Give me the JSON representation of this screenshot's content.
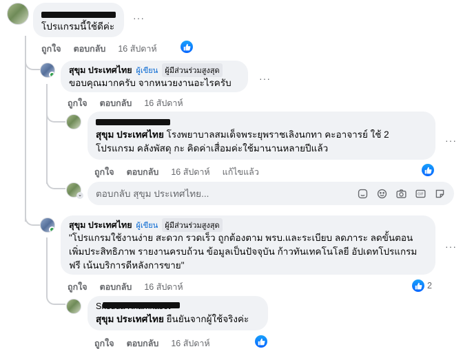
{
  "comments": [
    {
      "text": "โปรแกรมนี้ใช้ดีค่ะ",
      "like": "ถูกใจ",
      "reply": "ตอบกลับ",
      "time": "16 สัปดาห์"
    },
    {
      "name": "สุขุม ประเทศไทย",
      "badge_author": "ผู้เขียน",
      "badge_top": "ผู้มีส่วนร่วมสูงสุด",
      "text": "ขอบคุณมากครับ จากหนวยงานอะไรครับ",
      "like": "ถูกใจ",
      "reply": "ตอบกลับ",
      "time": "16 สัปดาห์"
    },
    {
      "mention": "สุขุม ประเทศไทย",
      "text": " โรงพยาบาลสมเด็จพระยุพราชเลิงนกทา คะอาจารย์ ใช้ 2 โปรแกรม คลังพัสดุ กะ คิดค่าเสื่อมค่ะใช้มานานหลายปีแล้ว",
      "like": "ถูกใจ",
      "reply": "ตอบกลับ",
      "time": "16 สัปดาห์",
      "edited": "แก้ไขแล้ว"
    },
    {
      "name": "สุขุม ประเทศไทย",
      "badge_author": "ผู้เขียน",
      "badge_top": "ผู้มีส่วนร่วมสูงสุด",
      "text": "\"โปรแกรมใช้งานง่าย สะดวก รวดเร็ว ถูกต้องตาม พรบ.และระเบียบ ลดภาระ ลดขั้นตอน เพิ่มประสิทธิภาพ รายงานครบถ้วน ข้อมูลเป็นปัจจุบัน ก้าวทันเทคโนโลยี อัปเดทโปรแกรมฟรี เน้นบริการดีหลังการขาย\"",
      "like": "ถูกใจ",
      "reply": "ตอบกลับ",
      "time": "16 สัปดาห์",
      "like_count": "2"
    },
    {
      "name_visible": "Srisuda Khamkaset",
      "mention": "สุขุม ประเทศไทย",
      "text": " ยืนยันจากผู้ใช้จริงค่ะ",
      "like": "ถูกใจ",
      "reply": "ตอบกลับ",
      "time": "16 สัปดาห์"
    }
  ],
  "reply_box": {
    "placeholder": "ตอบกลับ สุขุม ประเทศไทย..."
  },
  "colors": {
    "accent": "#0866ff",
    "bubble": "#f0f2f5",
    "muted": "#65676b"
  },
  "icons": [
    "more-icon",
    "like-reaction-icon",
    "sticker-icon",
    "emoji-icon",
    "camera-icon",
    "gif-icon",
    "avatar-sticker-icon"
  ]
}
